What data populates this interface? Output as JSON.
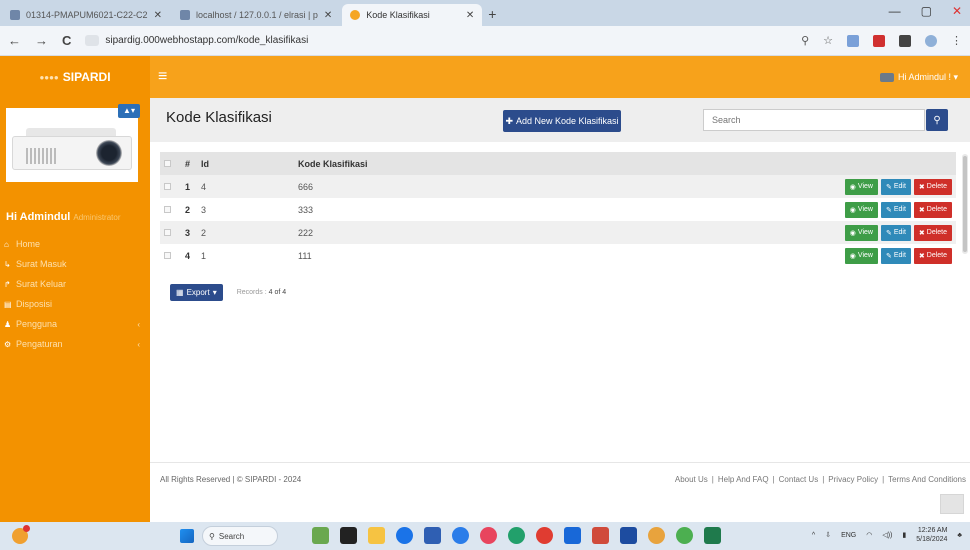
{
  "browser": {
    "tabs": [
      {
        "title": "01314-PMAPUM6021-C22-C2",
        "active": false
      },
      {
        "title": "localhost / 127.0.0.1 / elrasi | p",
        "active": false
      },
      {
        "title": "Kode Klasifikasi",
        "active": true
      }
    ],
    "url": "sipardig.000webhostapp.com/kode_klasifikasi",
    "new_tab": "+",
    "back": "←",
    "forward": "→",
    "reload": "C"
  },
  "header": {
    "brand": "SIPARDI",
    "brand_prefix": "●●●●",
    "menu_icon": "≡",
    "user_label": "Hi Admindul ! ▾"
  },
  "sidebar": {
    "badge": "▲▾",
    "greeting": "Hi Admindul",
    "role": "Administrator",
    "items": [
      {
        "icon": "home-icon",
        "glyph": "⌂",
        "label": "Home",
        "has_caret": false
      },
      {
        "icon": "inbox-icon",
        "glyph": "↳",
        "label": "Surat Masuk",
        "has_caret": false
      },
      {
        "icon": "outbox-icon",
        "glyph": "↱",
        "label": "Surat Keluar",
        "has_caret": false
      },
      {
        "icon": "disposisi-icon",
        "glyph": "▤",
        "label": "Disposisi",
        "has_caret": false
      },
      {
        "icon": "users-icon",
        "glyph": "♟",
        "label": "Pengguna",
        "has_caret": true
      },
      {
        "icon": "gear-icon",
        "glyph": "⚙",
        "label": "Pengaturan",
        "has_caret": true
      }
    ]
  },
  "page": {
    "title": "Kode Klasifikasi",
    "add_button": "Add New Kode Klasifikasi",
    "search_placeholder": "Search",
    "table": {
      "headers": {
        "no": "#",
        "id": "Id",
        "kode": "Kode Klasifikasi"
      },
      "rows": [
        {
          "no": "1",
          "id": "4",
          "kode": "666"
        },
        {
          "no": "2",
          "id": "3",
          "kode": "333"
        },
        {
          "no": "3",
          "id": "2",
          "kode": "222"
        },
        {
          "no": "4",
          "id": "1",
          "kode": "111"
        }
      ],
      "actions": {
        "view": "View",
        "edit": "Edit",
        "delete": "Delete"
      }
    },
    "export_button": "Export",
    "records_label": "Records :",
    "records_value": "4 of 4"
  },
  "footer": {
    "left": "All Rights Reserved | © SIPARDI - 2024",
    "links": [
      "About Us",
      "Help And FAQ",
      "Contact Us",
      "Privacy Policy",
      "Terms And Conditions"
    ],
    "separator": "|"
  },
  "taskbar": {
    "search": "Search",
    "lang": "ENG",
    "time": "12:26 AM",
    "date": "5/18/2024"
  },
  "colors": {
    "orange": "#f39200",
    "header_orange": "#f7a21b",
    "primary_blue": "#2c4c8c",
    "view_green": "#3e9d47",
    "edit_blue": "#2f8ab9",
    "delete_red": "#cf2f29"
  }
}
